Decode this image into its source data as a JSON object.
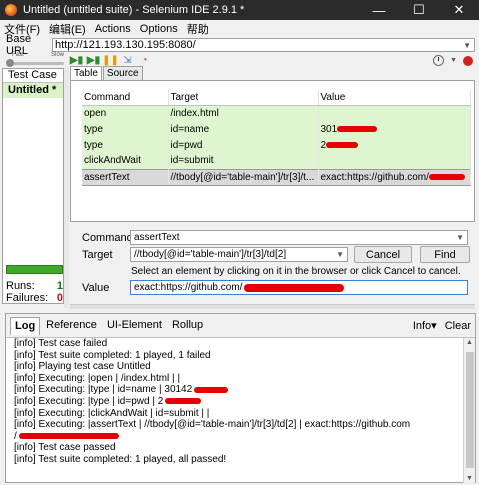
{
  "window": {
    "title": "Untitled (untitled suite) - Selenium IDE 2.9.1 *",
    "min": "—",
    "max": "☐",
    "close": "✕"
  },
  "menu": [
    "文件(F)",
    "编辑(E)",
    "Actions",
    "Options",
    "帮助"
  ],
  "base_url": {
    "label": "Base URL",
    "value": "http://121.193.130.195:8080/"
  },
  "speed": {
    "fast": "Fast",
    "slow": "Slow"
  },
  "left_panel": {
    "header": "Test Case",
    "item": "Untitled *",
    "runs_label": "Runs:",
    "runs_value": "1",
    "failures_label": "Failures:",
    "failures_value": "0"
  },
  "tabs": [
    "Table",
    "Source"
  ],
  "table": {
    "headers": [
      "Command",
      "Target",
      "Value"
    ],
    "rows": [
      {
        "command": "open",
        "target": "/index.html",
        "value": ""
      },
      {
        "command": "type",
        "target": "id=name",
        "value": "301"
      },
      {
        "command": "type",
        "target": "id=pwd",
        "value": "2"
      },
      {
        "command": "clickAndWait",
        "target": "id=submit",
        "value": ""
      },
      {
        "command": "assertText",
        "target": "//tbody[@id='table-main']/tr[3]/t...",
        "value": "exact:https://github.com/"
      }
    ]
  },
  "editor": {
    "command_label": "Command",
    "command_value": "assertText",
    "target_label": "Target",
    "target_value": "//tbody[@id='table-main']/tr[3]/td[2]",
    "cancel": "Cancel",
    "find": "Find",
    "hint": "Select an element by clicking on it in the browser or click Cancel to cancel.",
    "value_label": "Value",
    "value_value": "exact:https://github.com/"
  },
  "log": {
    "tabs": [
      "Log",
      "Reference",
      "UI-Element",
      "Rollup"
    ],
    "info": "Info▾",
    "clear": "Clear",
    "lines": [
      "[info] Test case failed",
      "[info] Test suite completed: 1 played, 1 failed",
      "[info] Playing test case Untitled",
      "[info] Executing: |open | /index.html | |",
      "[info] Executing: |type | id=name | 30142",
      "[info] Executing: |type | id=pwd | 2",
      "[info] Executing: |clickAndWait | id=submit | |",
      "[info] Executing: |assertText | //tbody[@id='table-main']/tr[3]/td[2] | exact:https://github.com",
      "/",
      "[info] Test case passed",
      "[info] Test suite completed: 1 played, all passed!"
    ]
  }
}
